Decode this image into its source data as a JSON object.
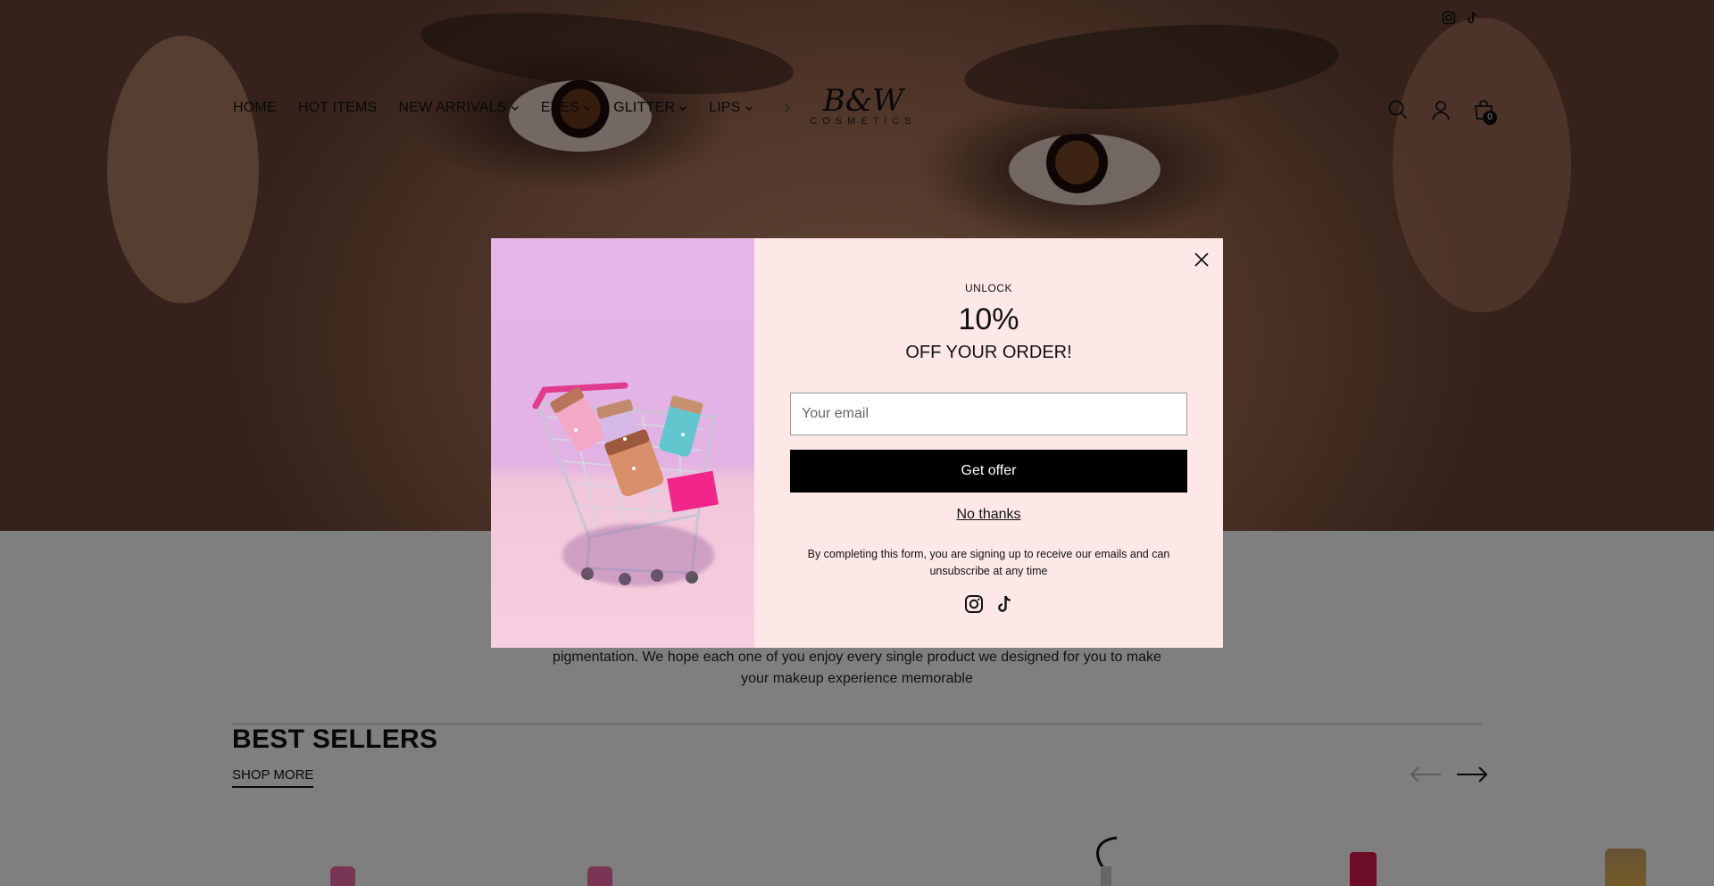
{
  "header": {
    "nav": [
      {
        "label": "HOME",
        "has_dropdown": false
      },
      {
        "label": "HOT ITEMS",
        "has_dropdown": false
      },
      {
        "label": "NEW ARRIVALS",
        "has_dropdown": true
      },
      {
        "label": "EYES",
        "has_dropdown": true
      },
      {
        "label": "GLITTER",
        "has_dropdown": true
      },
      {
        "label": "LIPS",
        "has_dropdown": true
      }
    ],
    "logo_main": "B&W",
    "logo_sub": "COSMETICS",
    "cart_count": "0",
    "icons": [
      "instagram-icon",
      "tiktok-icon",
      "search-icon",
      "account-icon",
      "cart-icon",
      "chevron-right-icon"
    ]
  },
  "main": {
    "intro_text": "pigmentation. We hope each one of you enjoy every single product we designed for you to make your makeup experience memorable",
    "best_sellers_title": "BEST SELLERS",
    "shop_more_label": "SHOP MORE"
  },
  "popup": {
    "unlock_label": "UNLOCK",
    "discount": "10%",
    "subtitle": "OFF YOUR ORDER!",
    "email_placeholder": "Your email",
    "cta_label": "Get offer",
    "decline_label": "No thanks",
    "disclaimer": "By completing this form, you are signing up to receive our emails and can unsubscribe at any time"
  },
  "colors": {
    "popup_bg": "#fde8e7",
    "button_bg": "#000000",
    "overlay": "rgba(0,0,0,0.5)"
  }
}
